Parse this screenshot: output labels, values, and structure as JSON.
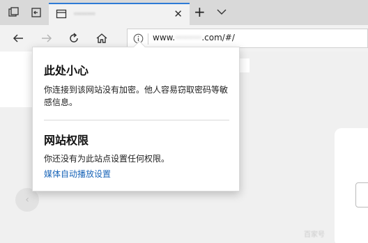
{
  "tab": {
    "title": "········"
  },
  "address": {
    "url_prefix": "www.",
    "url_blurred": "··········",
    "url_suffix": ".com/#/"
  },
  "popup": {
    "heading_security": "此处小心",
    "body_security": "你连接到该网站没有加密。他人容易窃取密码等敏感信息。",
    "heading_permissions": "网站权限",
    "body_permissions": "你还没有为此站点设置任何权限。",
    "link_media": "媒体自动播放设置"
  },
  "page": {
    "carousel_prev": "‹",
    "watermark": "百家号"
  },
  "icons": {
    "tab_manager": "tab-manager-icon",
    "set_aside": "set-aside-tabs-icon",
    "page": "page-icon",
    "close": "close-icon",
    "new_tab": "plus-icon",
    "tab_list": "chevron-down-icon",
    "back": "arrow-left-icon",
    "forward": "arrow-right-icon",
    "refresh": "refresh-icon",
    "home": "home-icon",
    "info": "info-icon"
  },
  "colors": {
    "accent": "#2d7bd6",
    "link": "#1a65b8"
  }
}
